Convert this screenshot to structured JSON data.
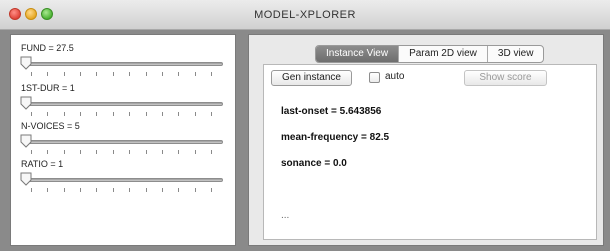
{
  "window": {
    "title": "MODEL-XPLORER"
  },
  "sliders": [
    {
      "label": "FUND = 27.5",
      "value": 27.5,
      "position": 0
    },
    {
      "label": "1ST-DUR = 1",
      "value": 1,
      "position": 0
    },
    {
      "label": "N-VOICES = 5",
      "value": 5,
      "position": 0
    },
    {
      "label": "RATIO = 1",
      "value": 1,
      "position": 0
    }
  ],
  "tabs": [
    {
      "label": "Instance View",
      "active": true
    },
    {
      "label": "Param 2D view",
      "active": false
    },
    {
      "label": "3D view",
      "active": false
    }
  ],
  "toolbar": {
    "gen_label": "Gen instance",
    "auto_label": "auto",
    "auto_checked": false,
    "score_label": "Show score",
    "score_enabled": false
  },
  "results": [
    {
      "text": "last-onset = 5.643856"
    },
    {
      "text": "mean-frequency = 82.5"
    },
    {
      "text": "sonance = 0.0"
    }
  ],
  "ellipsis": "...",
  "colors": {
    "active_tab": "#7a7a7a",
    "close": "#e0443a",
    "minimize": "#e6a824",
    "maximize": "#4cb233"
  }
}
